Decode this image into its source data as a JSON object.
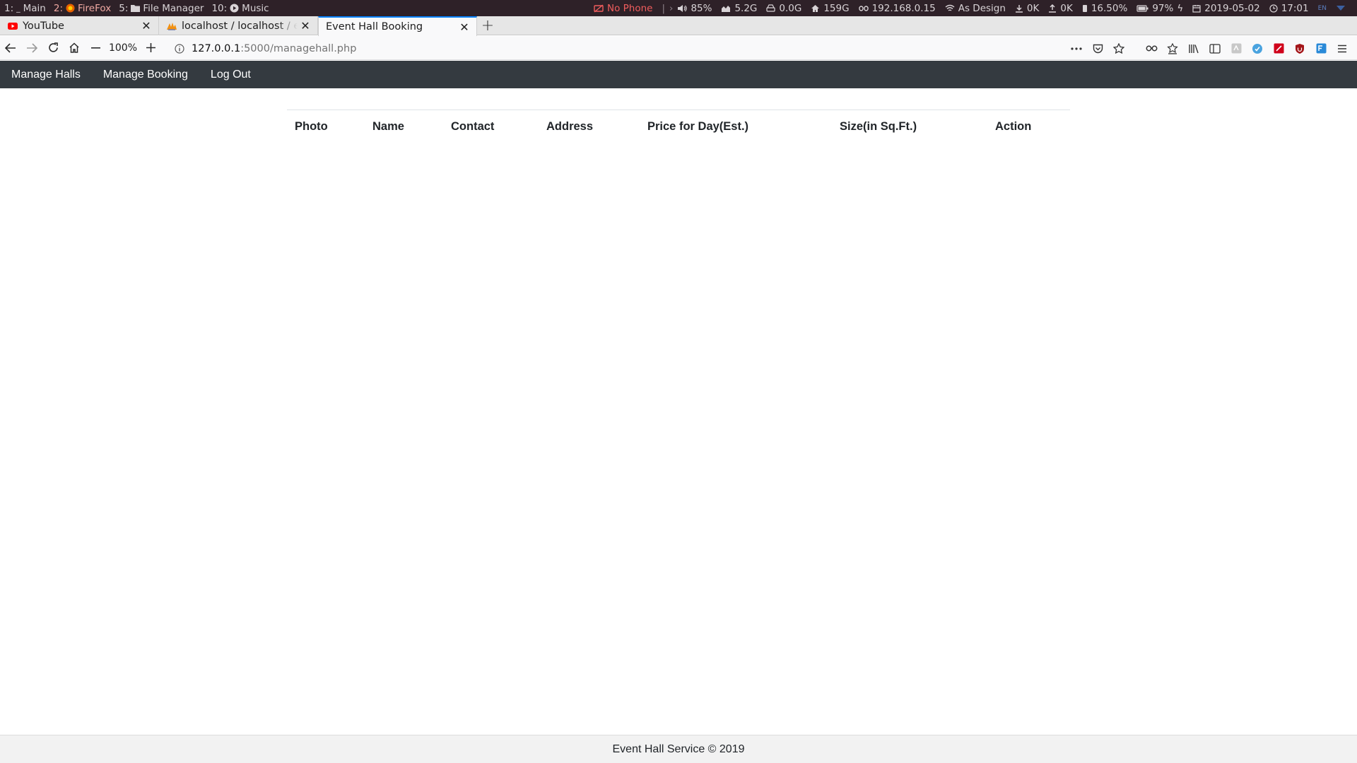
{
  "system_bar": {
    "workspaces": [
      {
        "num": "1:",
        "icon": "terminal-icon",
        "label": "Main"
      },
      {
        "num": "2:",
        "icon": "firefox-icon",
        "label": "FireFox"
      },
      {
        "num": "5:",
        "icon": "folder-icon",
        "label": "File Manager"
      },
      {
        "num": "10:",
        "icon": "play-icon",
        "label": "Music"
      }
    ],
    "phone": "No Phone",
    "volume": "85%",
    "memory": "5.2G",
    "swap": "0.0G",
    "home_disk": "159G",
    "ip": "192.168.0.15",
    "wifi": "As Design",
    "download": "0K",
    "upload": "0K",
    "cpu": "16.50%",
    "battery": "97%",
    "date": "2019-05-02",
    "time": "17:01",
    "lang": "EN"
  },
  "tabs": [
    {
      "title": "YouTube",
      "icon": "youtube-icon",
      "active": false
    },
    {
      "title": "localhost / localhost / ev",
      "icon": "phpmyadmin-icon",
      "active": false
    },
    {
      "title": "Event Hall Booking",
      "icon": "",
      "active": true
    }
  ],
  "toolbar": {
    "zoom": "100%",
    "url_host": "127.0.0.1",
    "url_path": ":5000/managehall.php"
  },
  "nav": {
    "items": [
      "Manage Halls",
      "Manage Booking",
      "Log Out"
    ]
  },
  "table": {
    "headers": [
      "Photo",
      "Name",
      "Contact",
      "Address",
      "Price for Day(Est.)",
      "Size(in Sq.Ft.)",
      "Action"
    ]
  },
  "footer": {
    "text": "Event Hall Service © 2019"
  },
  "colors": {
    "navbar_bg": "#343a40",
    "active_tab_accent": "#0a84ff",
    "alert": "#f05d5d"
  }
}
